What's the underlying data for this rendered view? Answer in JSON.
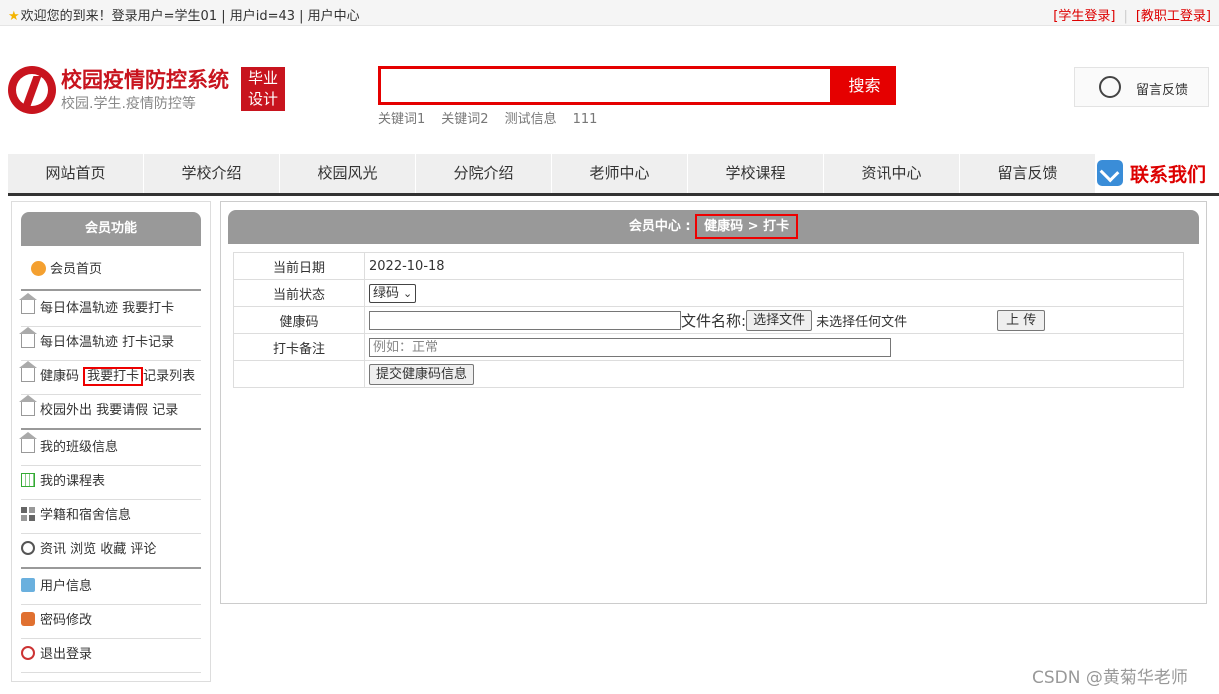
{
  "topbar": {
    "welcome": "欢迎您的到来！登录用户=学生01 | 用户id=43 | 用户中心",
    "student_login": "[学生登录]",
    "staff_login": "[教职工登录]"
  },
  "logo": {
    "title": "校园疫情防控系统",
    "subtitle": "校园.学生.疫情防控等",
    "badge_line1": "毕业",
    "badge_line2": "设计"
  },
  "search": {
    "button": "搜索",
    "keywords": [
      "关键词1",
      "关键词2",
      "测试信息",
      "111"
    ]
  },
  "feedback_box": {
    "label": "留言反馈"
  },
  "nav": {
    "items": [
      "网站首页",
      "学校介绍",
      "校园风光",
      "分院介绍",
      "老师中心",
      "学校课程",
      "资讯中心",
      "留言反馈"
    ],
    "contact": "联系我们"
  },
  "sidebar": {
    "header": "会员功能",
    "home": "会员首页",
    "menu": [
      {
        "label": "每日体温轨迹 我要打卡",
        "icon": "house-icon"
      },
      {
        "label": "每日体温轨迹 打卡记录",
        "icon": "house-icon"
      },
      {
        "label_a": "健康码",
        "label_b": "我要打卡",
        "label_c": "记录列表",
        "icon": "house-icon"
      },
      {
        "label": "校园外出 我要请假 记录",
        "icon": "house-icon"
      },
      {
        "label": "我的班级信息",
        "icon": "house-icon"
      },
      {
        "label": "我的课程表",
        "icon": "calendar-icon"
      },
      {
        "label": "学籍和宿舍信息",
        "icon": "grid-icon"
      },
      {
        "label": "资讯 浏览 收藏 评论",
        "icon": "clock-icon"
      },
      {
        "label": "用户信息",
        "icon": "user-icon"
      },
      {
        "label": "密码修改",
        "icon": "lock-icon"
      },
      {
        "label": "退出登录",
        "icon": "power-icon"
      }
    ]
  },
  "main": {
    "breadcrumb_prefix": "会员中心 :",
    "breadcrumb_current": "健康码 > 打卡",
    "form": {
      "date_label": "当前日期",
      "date_value": "2022-10-18",
      "status_label": "当前状态",
      "status_value": "绿码",
      "code_label": "健康码",
      "file_name_label": "文件名称:",
      "choose_file": "选择文件",
      "no_file": "未选择任何文件",
      "upload": "上 传",
      "note_label": "打卡备注",
      "note_placeholder": "例如：正常",
      "submit": "提交健康码信息"
    }
  },
  "watermark": "CSDN @黄菊华老师",
  "colors": {
    "accent": "#e50000",
    "header_gray": "#999999"
  }
}
